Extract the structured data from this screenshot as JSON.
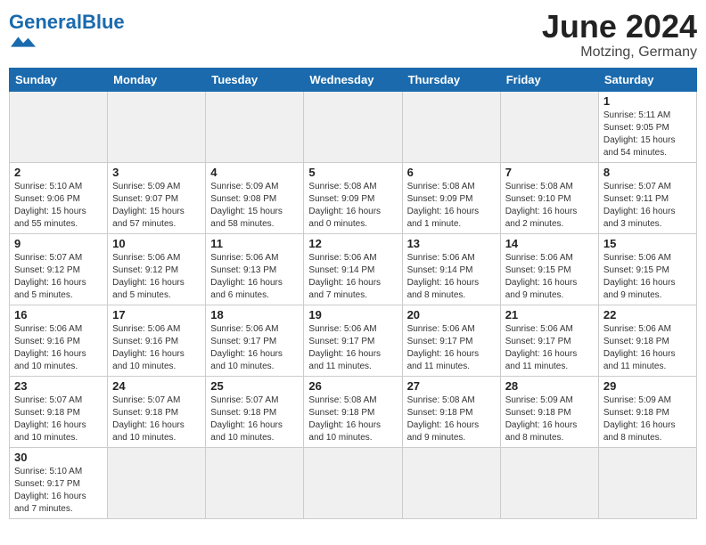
{
  "logo": {
    "text_general": "General",
    "text_blue": "Blue"
  },
  "title": "June 2024",
  "subtitle": "Motzing, Germany",
  "weekdays": [
    "Sunday",
    "Monday",
    "Tuesday",
    "Wednesday",
    "Thursday",
    "Friday",
    "Saturday"
  ],
  "weeks": [
    [
      {
        "day": "",
        "info": ""
      },
      {
        "day": "",
        "info": ""
      },
      {
        "day": "",
        "info": ""
      },
      {
        "day": "",
        "info": ""
      },
      {
        "day": "",
        "info": ""
      },
      {
        "day": "",
        "info": ""
      },
      {
        "day": "1",
        "info": "Sunrise: 5:11 AM\nSunset: 9:05 PM\nDaylight: 15 hours\nand 54 minutes."
      }
    ],
    [
      {
        "day": "2",
        "info": "Sunrise: 5:10 AM\nSunset: 9:06 PM\nDaylight: 15 hours\nand 55 minutes."
      },
      {
        "day": "3",
        "info": "Sunrise: 5:09 AM\nSunset: 9:07 PM\nDaylight: 15 hours\nand 57 minutes."
      },
      {
        "day": "4",
        "info": "Sunrise: 5:09 AM\nSunset: 9:08 PM\nDaylight: 15 hours\nand 58 minutes."
      },
      {
        "day": "5",
        "info": "Sunrise: 5:08 AM\nSunset: 9:09 PM\nDaylight: 16 hours\nand 0 minutes."
      },
      {
        "day": "6",
        "info": "Sunrise: 5:08 AM\nSunset: 9:09 PM\nDaylight: 16 hours\nand 1 minute."
      },
      {
        "day": "7",
        "info": "Sunrise: 5:08 AM\nSunset: 9:10 PM\nDaylight: 16 hours\nand 2 minutes."
      },
      {
        "day": "8",
        "info": "Sunrise: 5:07 AM\nSunset: 9:11 PM\nDaylight: 16 hours\nand 3 minutes."
      }
    ],
    [
      {
        "day": "9",
        "info": "Sunrise: 5:07 AM\nSunset: 9:12 PM\nDaylight: 16 hours\nand 5 minutes."
      },
      {
        "day": "10",
        "info": "Sunrise: 5:06 AM\nSunset: 9:12 PM\nDaylight: 16 hours\nand 5 minutes."
      },
      {
        "day": "11",
        "info": "Sunrise: 5:06 AM\nSunset: 9:13 PM\nDaylight: 16 hours\nand 6 minutes."
      },
      {
        "day": "12",
        "info": "Sunrise: 5:06 AM\nSunset: 9:14 PM\nDaylight: 16 hours\nand 7 minutes."
      },
      {
        "day": "13",
        "info": "Sunrise: 5:06 AM\nSunset: 9:14 PM\nDaylight: 16 hours\nand 8 minutes."
      },
      {
        "day": "14",
        "info": "Sunrise: 5:06 AM\nSunset: 9:15 PM\nDaylight: 16 hours\nand 9 minutes."
      },
      {
        "day": "15",
        "info": "Sunrise: 5:06 AM\nSunset: 9:15 PM\nDaylight: 16 hours\nand 9 minutes."
      }
    ],
    [
      {
        "day": "16",
        "info": "Sunrise: 5:06 AM\nSunset: 9:16 PM\nDaylight: 16 hours\nand 10 minutes."
      },
      {
        "day": "17",
        "info": "Sunrise: 5:06 AM\nSunset: 9:16 PM\nDaylight: 16 hours\nand 10 minutes."
      },
      {
        "day": "18",
        "info": "Sunrise: 5:06 AM\nSunset: 9:17 PM\nDaylight: 16 hours\nand 10 minutes."
      },
      {
        "day": "19",
        "info": "Sunrise: 5:06 AM\nSunset: 9:17 PM\nDaylight: 16 hours\nand 11 minutes."
      },
      {
        "day": "20",
        "info": "Sunrise: 5:06 AM\nSunset: 9:17 PM\nDaylight: 16 hours\nand 11 minutes."
      },
      {
        "day": "21",
        "info": "Sunrise: 5:06 AM\nSunset: 9:17 PM\nDaylight: 16 hours\nand 11 minutes."
      },
      {
        "day": "22",
        "info": "Sunrise: 5:06 AM\nSunset: 9:18 PM\nDaylight: 16 hours\nand 11 minutes."
      }
    ],
    [
      {
        "day": "23",
        "info": "Sunrise: 5:07 AM\nSunset: 9:18 PM\nDaylight: 16 hours\nand 10 minutes."
      },
      {
        "day": "24",
        "info": "Sunrise: 5:07 AM\nSunset: 9:18 PM\nDaylight: 16 hours\nand 10 minutes."
      },
      {
        "day": "25",
        "info": "Sunrise: 5:07 AM\nSunset: 9:18 PM\nDaylight: 16 hours\nand 10 minutes."
      },
      {
        "day": "26",
        "info": "Sunrise: 5:08 AM\nSunset: 9:18 PM\nDaylight: 16 hours\nand 10 minutes."
      },
      {
        "day": "27",
        "info": "Sunrise: 5:08 AM\nSunset: 9:18 PM\nDaylight: 16 hours\nand 9 minutes."
      },
      {
        "day": "28",
        "info": "Sunrise: 5:09 AM\nSunset: 9:18 PM\nDaylight: 16 hours\nand 8 minutes."
      },
      {
        "day": "29",
        "info": "Sunrise: 5:09 AM\nSunset: 9:18 PM\nDaylight: 16 hours\nand 8 minutes."
      }
    ],
    [
      {
        "day": "30",
        "info": "Sunrise: 5:10 AM\nSunset: 9:17 PM\nDaylight: 16 hours\nand 7 minutes."
      },
      {
        "day": "",
        "info": ""
      },
      {
        "day": "",
        "info": ""
      },
      {
        "day": "",
        "info": ""
      },
      {
        "day": "",
        "info": ""
      },
      {
        "day": "",
        "info": ""
      },
      {
        "day": "",
        "info": ""
      }
    ]
  ]
}
